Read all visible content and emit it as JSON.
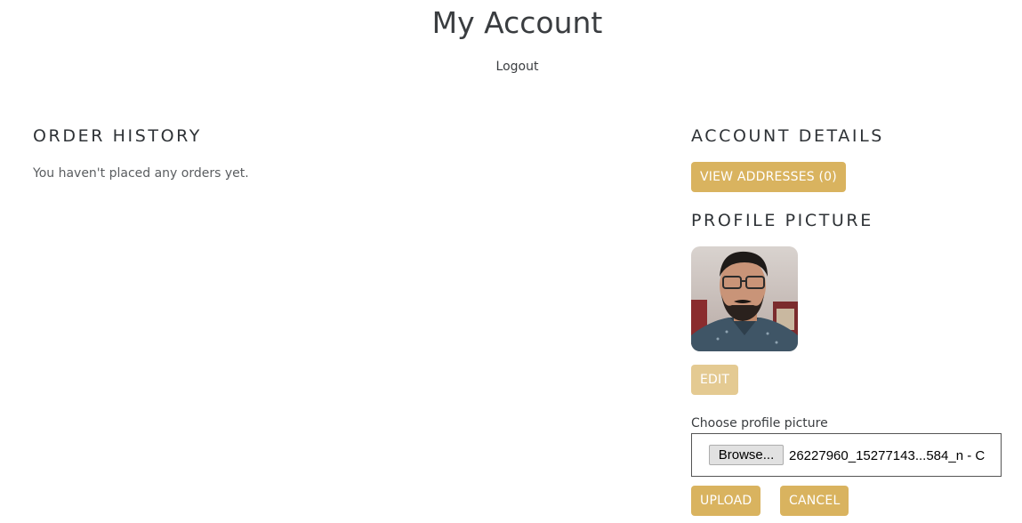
{
  "header": {
    "title": "My Account",
    "logout_label": "Logout"
  },
  "order_history": {
    "heading": "ORDER HISTORY",
    "empty_message": "You haven't placed any orders yet."
  },
  "account_details": {
    "heading": "ACCOUNT DETAILS",
    "view_addresses_label": "VIEW ADDRESSES (0)"
  },
  "profile_picture": {
    "heading": "PROFILE PICTURE",
    "edit_label": "EDIT",
    "choose_label": "Choose profile picture",
    "browse_label": "Browse...",
    "file_name": "26227960_15277143...584_n - C",
    "upload_label": "UPLOAD",
    "cancel_label": "CANCEL"
  },
  "colors": {
    "accent": "#d9b35f",
    "accent_disabled": "#e4ca92",
    "text": "#3a3d40"
  },
  "icons": {
    "avatar": "profile-photo"
  }
}
